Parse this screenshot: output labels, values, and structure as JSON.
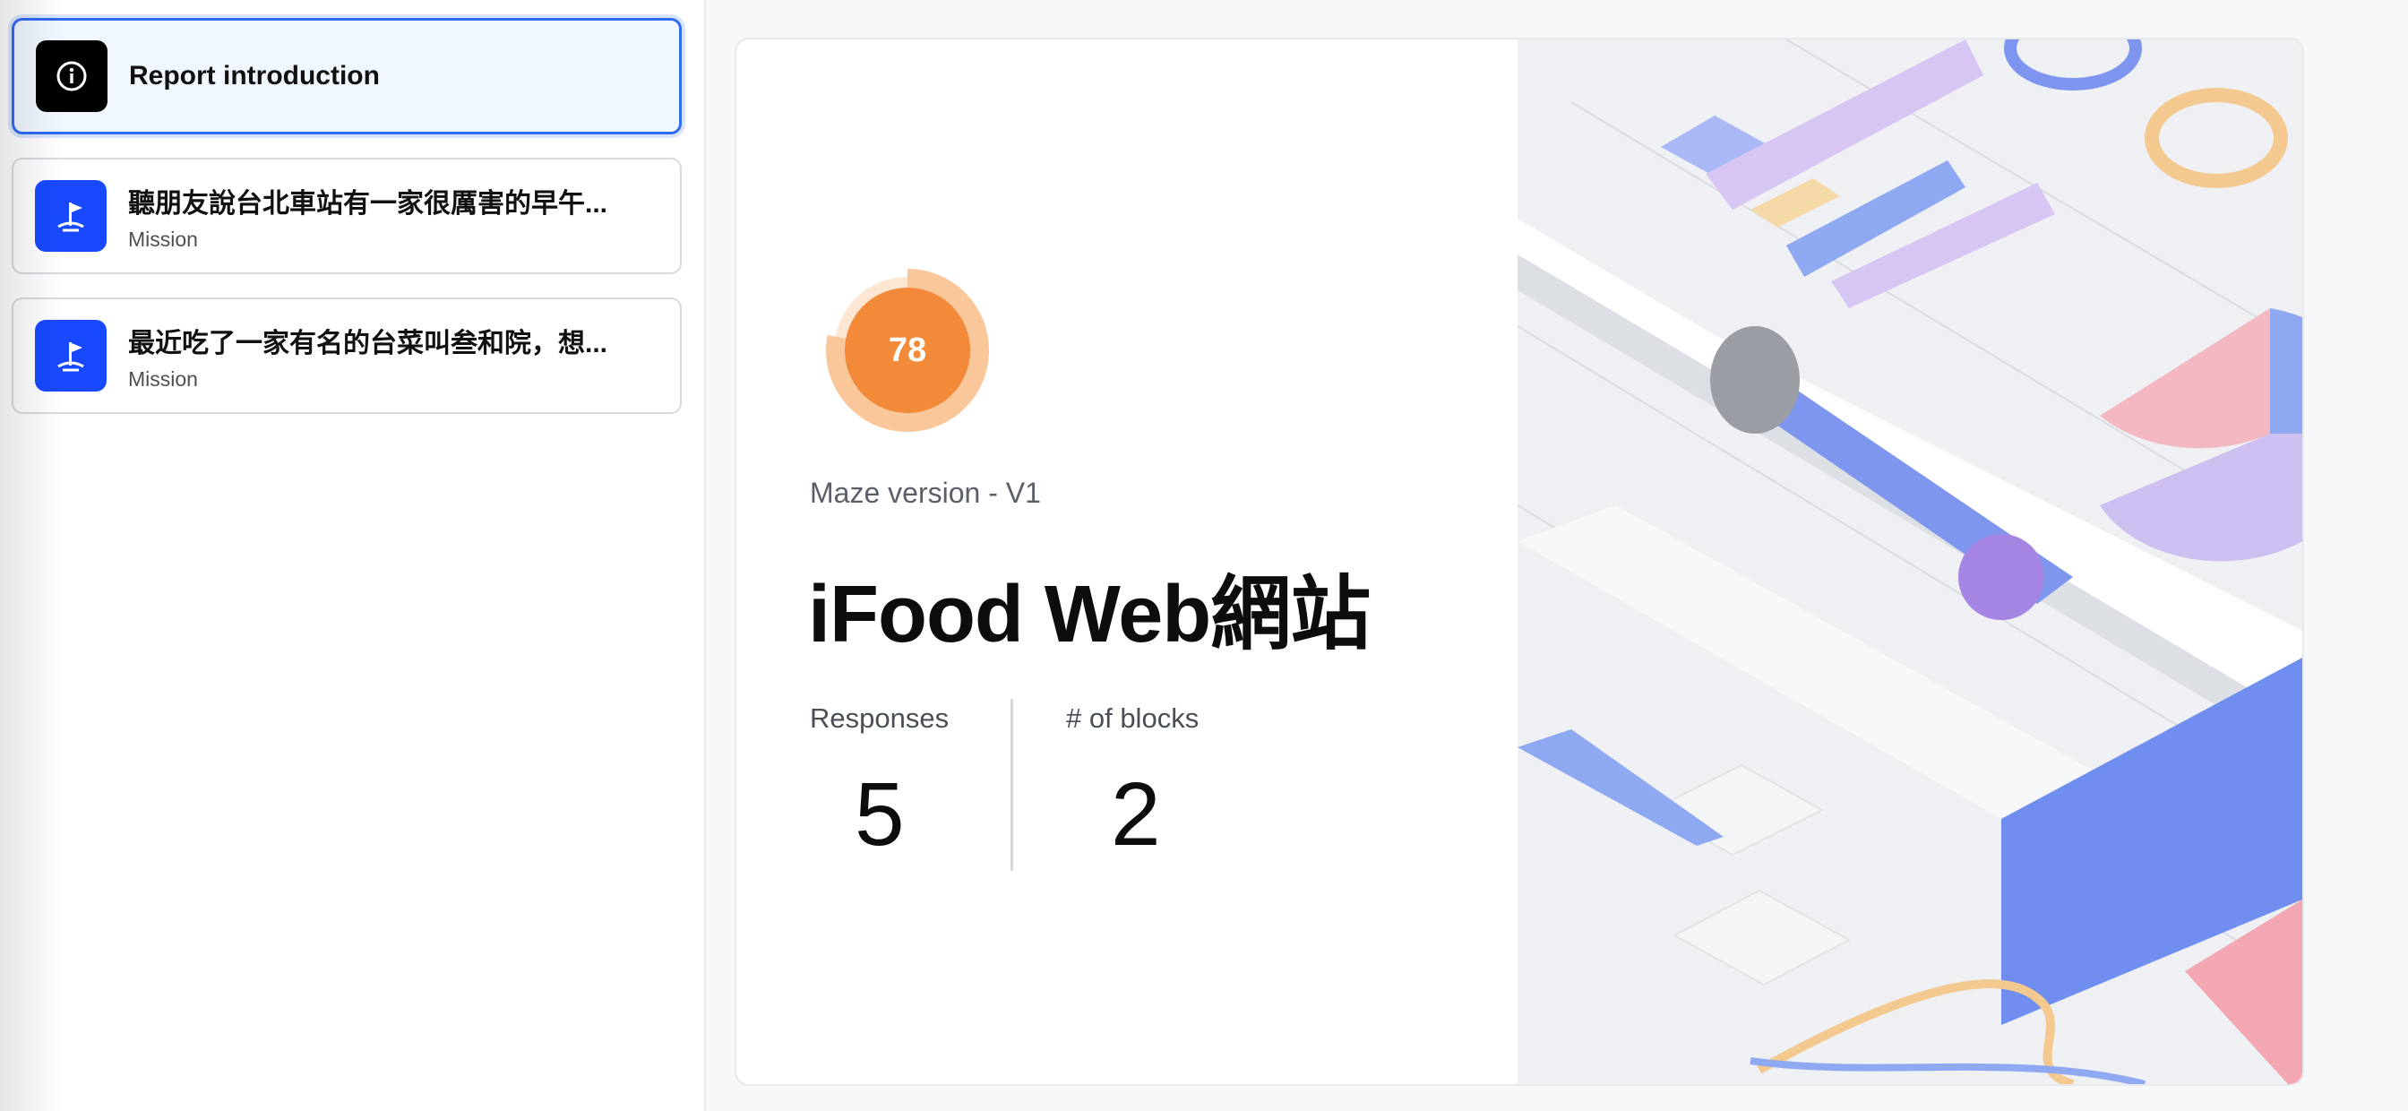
{
  "sidebar": {
    "items": [
      {
        "title": "Report introduction",
        "subtitle": "",
        "icon": "info-icon"
      },
      {
        "title": "聽朋友說台北車站有一家很厲害的早午...",
        "subtitle": "Mission",
        "icon": "mission-flag-icon"
      },
      {
        "title": "最近吃了一家有名的台菜叫叁和院，想...",
        "subtitle": "Mission",
        "icon": "mission-flag-icon"
      }
    ]
  },
  "report": {
    "score": "78",
    "score_fraction": 0.78,
    "version": "Maze version - V1",
    "title": "iFood Web網站",
    "stats": [
      {
        "label": "Responses",
        "value": "5"
      },
      {
        "label": "# of blocks",
        "value": "2"
      }
    ]
  },
  "colors": {
    "accent_blue": "#1849ff",
    "active_border": "#2f6bf5",
    "score_orange": "#f28a3a",
    "score_ring_light": "#f9c79a"
  }
}
